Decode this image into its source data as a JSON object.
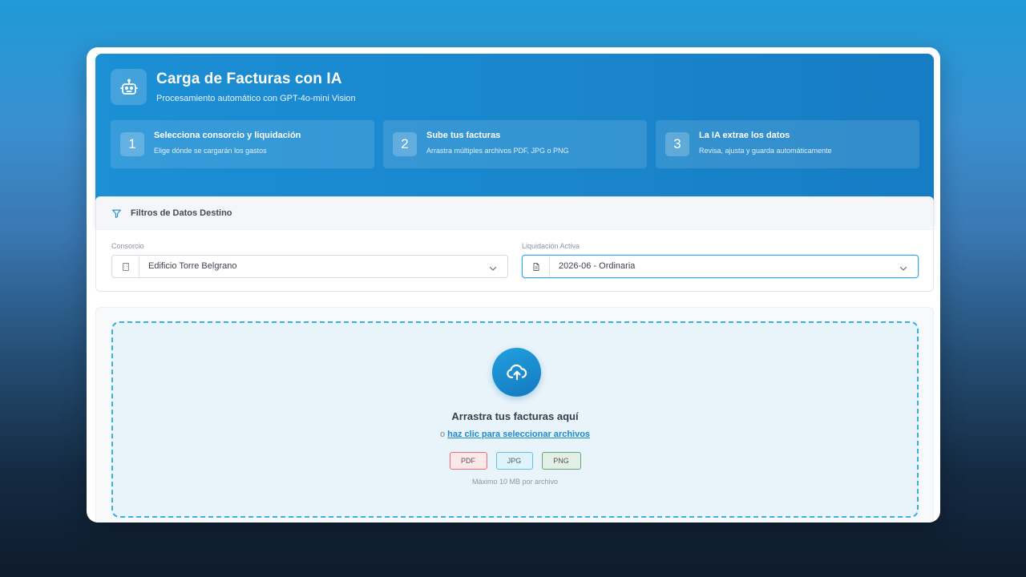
{
  "header": {
    "title": "Carga de Facturas con IA",
    "subtitle": "Procesamiento automático con GPT-4o-mini Vision",
    "icon": "robot-icon",
    "steps": [
      {
        "num": "1",
        "title": "Selecciona consorcio y liquidación",
        "desc": "Elige dónde se cargarán los gastos"
      },
      {
        "num": "2",
        "title": "Sube tus facturas",
        "desc": "Arrastra múltiples archivos PDF, JPG o PNG"
      },
      {
        "num": "3",
        "title": "La IA extrae los datos",
        "desc": "Revisa, ajusta y guarda automáticamente"
      }
    ]
  },
  "filters": {
    "title": "Filtros de Datos Destino",
    "icon": "filter-icon",
    "consorcio": {
      "label": "Consorcio",
      "value": "Edificio Torre Belgrano",
      "icon": "building-icon"
    },
    "liquidacion": {
      "label": "Liquidación Activa",
      "value": "2026-06 - Ordinaria",
      "icon": "document-icon"
    }
  },
  "upload": {
    "icon": "cloud-upload-icon",
    "title": "Arrastra tus facturas aquí",
    "prefix": "o",
    "link": "haz clic para seleccionar archivos",
    "formats": [
      "PDF",
      "JPG",
      "PNG"
    ],
    "max_size": "Máximo 10 MB por archivo"
  },
  "colors": {
    "accent": "#1a8ccf",
    "hero": "#1c8fd5",
    "pdf": "#e3707a",
    "jpg": "#5fc1e4",
    "png": "#5fa878"
  }
}
